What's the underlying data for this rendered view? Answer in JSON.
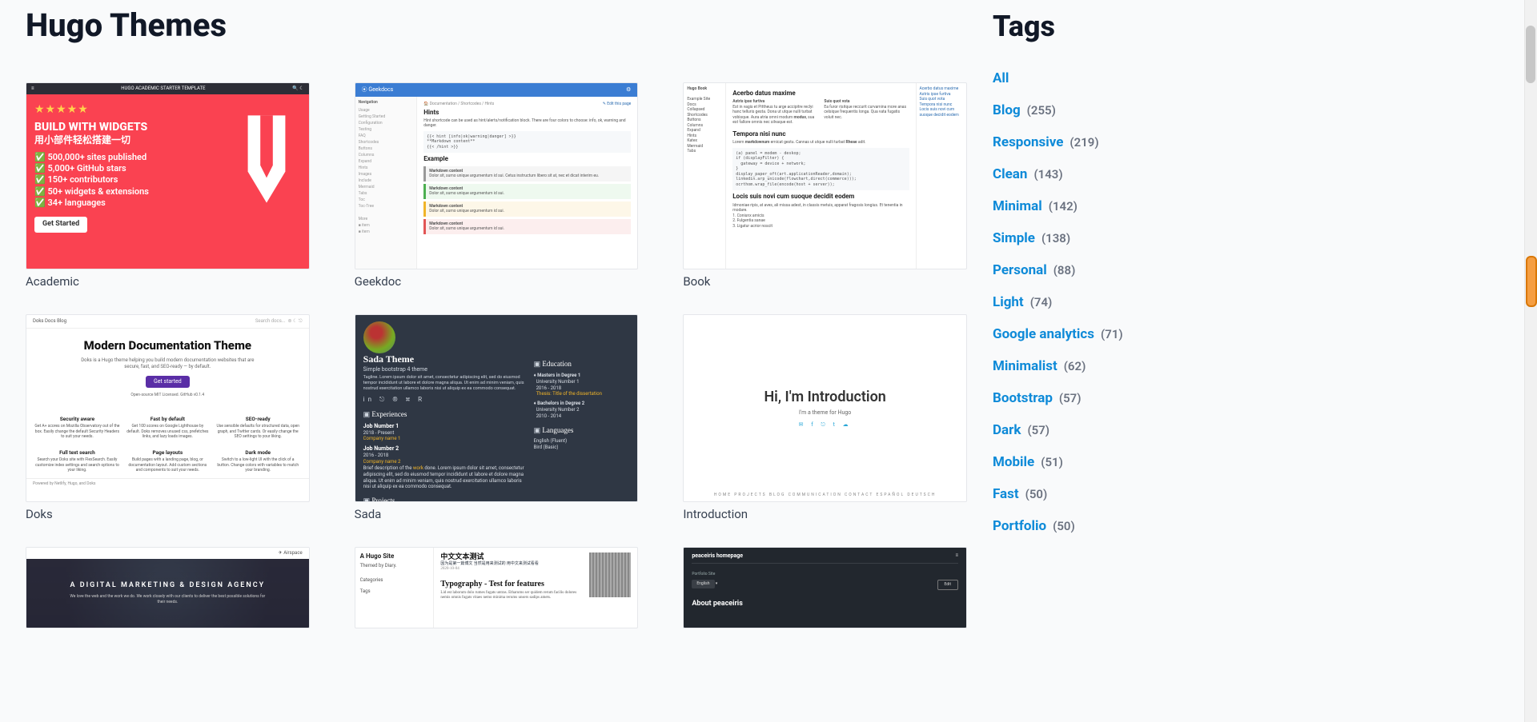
{
  "page_title": "Hugo Themes",
  "themes": [
    {
      "name": "Academic"
    },
    {
      "name": "Geekdoc"
    },
    {
      "name": "Book"
    },
    {
      "name": "Doks"
    },
    {
      "name": "Sada"
    },
    {
      "name": "Introduction"
    },
    {
      "name": ""
    },
    {
      "name": ""
    },
    {
      "name": ""
    }
  ],
  "sidebar_title": "Tags",
  "tags": [
    {
      "name": "All",
      "count": null
    },
    {
      "name": "Blog",
      "count": 255
    },
    {
      "name": "Responsive",
      "count": 219
    },
    {
      "name": "Clean",
      "count": 143
    },
    {
      "name": "Minimal",
      "count": 142
    },
    {
      "name": "Simple",
      "count": 138
    },
    {
      "name": "Personal",
      "count": 88
    },
    {
      "name": "Light",
      "count": 74
    },
    {
      "name": "Google analytics",
      "count": 71
    },
    {
      "name": "Minimalist",
      "count": 62
    },
    {
      "name": "Bootstrap",
      "count": 57
    },
    {
      "name": "Dark",
      "count": 57
    },
    {
      "name": "Mobile",
      "count": 51
    },
    {
      "name": "Fast",
      "count": 50
    },
    {
      "name": "Portfolio",
      "count": 50
    }
  ],
  "thumb": {
    "academic": {
      "topbar_title": "HUGO ACADEMIC STARTER TEMPLATE",
      "headline": "BUILD WITH WIDGETS",
      "headline_cn": "用小部件轻松搭建一切",
      "bullets": [
        "500,000+ sites published",
        "5,000+ GitHub stars",
        "150+ contributors",
        "50+ widgets & extensions",
        "34+ languages"
      ],
      "cta": "Get Started"
    },
    "geekdoc": {
      "brand": "Geekdocs",
      "nav_label": "Navigation",
      "h_hints": "Hints",
      "h_example": "Example",
      "block_label": "Markdown content",
      "crumb": "Documentation / Shortcodes / Hints",
      "edit": "Edit this page"
    },
    "book": {
      "brand": "Hugo Book",
      "title": "Acerbo datus maxime",
      "sub1": "Astris ipse furtiva",
      "sub2": "Suis quot vota",
      "sub3": "Tempora nisi nunc",
      "sub4": "Locis suis novi cum suoque decidit eodem",
      "side_item": "Example Site"
    },
    "doks": {
      "nav_left": "Doks   Docs   Blog",
      "nav_search": "Search docs...",
      "headline": "Modern Documentation Theme",
      "tagline": "Doks is a Hugo theme helping you build modern documentation websites that are secure, fast, and SEO-ready — by default.",
      "cta": "Get started",
      "meta": "Open-source MIT Licensed. GitHub v0.1.4",
      "cols": [
        {
          "h": "Security aware",
          "p": "Get A+ scores on Mozilla Observatory out of the box. Easily change the default Security Headers to suit your needs."
        },
        {
          "h": "Fast by default",
          "p": "Get 100 scores on Google Lighthouse by default. Doks removes unused css, prefetches links, and lazy loads images."
        },
        {
          "h": "SEO-ready",
          "p": "Use sensible defaults for structured data, open graph, and Twitter cards. Or easily change the SEO settings to your liking."
        },
        {
          "h": "Full text search",
          "p": "Search your Doks site with FlexSearch. Easily customize index settings and search options to your liking."
        },
        {
          "h": "Page layouts",
          "p": "Build pages with a landing page, blog, or documentation layout. Add custom sections and components to suit your needs."
        },
        {
          "h": "Dark mode",
          "p": "Switch to a low-light UI with the click of a button. Change colors with variables to match your branding."
        }
      ],
      "footer": "Powered by Netlify, Hugo, and Doks"
    },
    "sada": {
      "title": "Sada Theme",
      "subtitle": "Simple bootstrap 4 theme",
      "section_exp": "Experiences",
      "section_edu": "Education",
      "section_lang": "Languages",
      "section_proj": "Projects",
      "job1": "Job Number 1",
      "job1_dates": "2018 - Present",
      "job1_company": "Company name 1",
      "job2": "Job Number 2",
      "job2_dates": "2016 - 2018",
      "job2_company": "Company name 2",
      "edu1": "Masters in Degree 1",
      "edu1_school": "University Number 1",
      "edu1_dates": "2016 - 2018",
      "edu1_thesis": "Thesis: Title of the dissertation",
      "edu2": "Bachelors in Degree 2",
      "edu2_school": "University Number 2",
      "edu2_dates": "2010 - 2014",
      "lang1": "English (Fluent)",
      "lang2": "Bird (Basic)"
    },
    "intro": {
      "headline": "Hi, I'm Introduction",
      "tagline": "I'm a theme for Hugo",
      "footer": "HOME   PROJECTS   BLOG   COMMUNICATION   CONTACT   ESPAÑOL   DEUTSCH"
    },
    "airspace": {
      "brand": "Airspace",
      "headline": "A DIGITAL MARKETING & DESIGN AGENCY",
      "tagline": "We love the web and the work we do. We work closely with our clients to deliver the best possible solutions for their needs."
    },
    "diary": {
      "site_title": "A Hugo Site",
      "site_sub": "Themed by Diary.",
      "cat": "Categories",
      "tags": "Tags",
      "post_title_cn": "中文文本测试",
      "post_date": "2020-10-04",
      "post_title": "Typography - Test for features",
      "post_body": "Lid est laborum dolo rumes fugats untras. Etharums ser quidem rerum facilis dolores nemis omnis fugats vitaes nemo minima rerums unsers sadips amets."
    },
    "iris": {
      "brand": "peaceiris homepage",
      "subnav": "Portfolio Site",
      "lang": "English",
      "btn": "Edit",
      "heading": "About peaceiris"
    }
  }
}
